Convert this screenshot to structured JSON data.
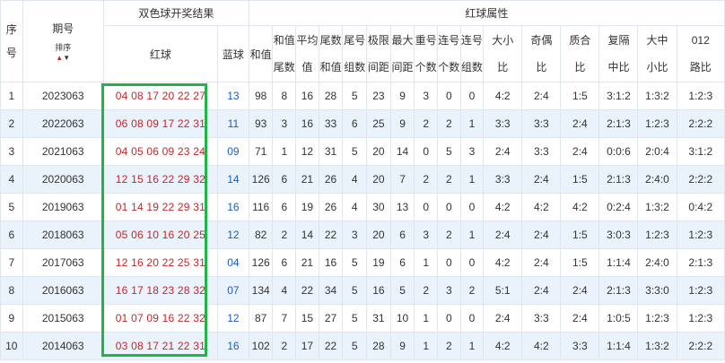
{
  "header": {
    "seq": "序号",
    "period": "期号",
    "sort_label": "排序",
    "sort_up": "▲",
    "sort_down": "▼",
    "group_title": "双色球开奖结果",
    "red_ball": "红球",
    "blue_ball": "蓝球",
    "attr_title": "红球属性",
    "cols": [
      "和值",
      "和值尾数",
      "平均值",
      "尾数和值",
      "尾号组数",
      "极限间距",
      "最大间距",
      "重号个数",
      "连号个数",
      "连号组数",
      "大小比",
      "奇偶比",
      "质合比",
      "复隔中比",
      "大中小比",
      "012路比"
    ]
  },
  "colors": {
    "red": "#c0282b",
    "blue": "#1a5fbf",
    "highlight": "#22b34a",
    "row_alt": "#eaf2fb"
  },
  "rows": [
    {
      "no": "1",
      "period": "2023063",
      "red": "04 08 17 20 22 27",
      "blue": "13",
      "v": [
        "98",
        "8",
        "16",
        "28",
        "5",
        "23",
        "9",
        "3",
        "0",
        "0",
        "4:2",
        "2:4",
        "1:5",
        "3:1:2",
        "1:3:2",
        "1:2:3"
      ]
    },
    {
      "no": "2",
      "period": "2022063",
      "red": "06 08 09 17 22 31",
      "blue": "11",
      "v": [
        "93",
        "3",
        "16",
        "33",
        "6",
        "25",
        "9",
        "2",
        "2",
        "1",
        "3:3",
        "3:3",
        "2:4",
        "2:1:3",
        "1:2:3",
        "2:2:2"
      ]
    },
    {
      "no": "3",
      "period": "2021063",
      "red": "04 05 06 09 23 24",
      "blue": "09",
      "v": [
        "71",
        "1",
        "12",
        "31",
        "5",
        "20",
        "14",
        "0",
        "5",
        "3",
        "2:4",
        "3:3",
        "2:4",
        "0:0:6",
        "2:0:4",
        "3:1:2"
      ]
    },
    {
      "no": "4",
      "period": "2020063",
      "red": "12 15 16 22 29 32",
      "blue": "14",
      "v": [
        "126",
        "6",
        "21",
        "26",
        "4",
        "20",
        "7",
        "2",
        "2",
        "1",
        "3:3",
        "2:4",
        "1:5",
        "2:1:3",
        "2:4:0",
        "2:2:2"
      ]
    },
    {
      "no": "5",
      "period": "2019063",
      "red": "01 14 19 22 29 31",
      "blue": "16",
      "v": [
        "116",
        "6",
        "19",
        "26",
        "4",
        "30",
        "13",
        "0",
        "0",
        "0",
        "4:2",
        "4:2",
        "4:2",
        "0:2:4",
        "1:3:2",
        "0:4:2"
      ]
    },
    {
      "no": "6",
      "period": "2018063",
      "red": "05 06 10 16 20 25",
      "blue": "12",
      "v": [
        "82",
        "2",
        "14",
        "22",
        "3",
        "20",
        "6",
        "3",
        "2",
        "1",
        "2:4",
        "2:4",
        "1:5",
        "3:0:3",
        "1:2:3",
        "1:2:3"
      ]
    },
    {
      "no": "7",
      "period": "2017063",
      "red": "12 16 20 22 25 31",
      "blue": "04",
      "v": [
        "126",
        "6",
        "21",
        "16",
        "5",
        "19",
        "6",
        "1",
        "0",
        "0",
        "4:2",
        "2:4",
        "1:5",
        "1:1:4",
        "2:4:0",
        "2:1:3"
      ]
    },
    {
      "no": "8",
      "period": "2016063",
      "red": "16 17 18 23 28 32",
      "blue": "07",
      "v": [
        "134",
        "4",
        "22",
        "34",
        "5",
        "16",
        "5",
        "2",
        "3",
        "2",
        "5:1",
        "2:4",
        "2:4",
        "2:1:3",
        "3:3:0",
        "1:2:3"
      ]
    },
    {
      "no": "9",
      "period": "2015063",
      "red": "01 07 09 16 22 32",
      "blue": "12",
      "v": [
        "87",
        "7",
        "15",
        "27",
        "5",
        "31",
        "10",
        "1",
        "0",
        "0",
        "2:4",
        "3:3",
        "2:4",
        "1:0:5",
        "1:2:3",
        "1:2:3"
      ]
    },
    {
      "no": "10",
      "period": "2014063",
      "red": "03 08 17 21 22 31",
      "blue": "16",
      "v": [
        "102",
        "2",
        "17",
        "22",
        "5",
        "28",
        "9",
        "1",
        "2",
        "1",
        "4:2",
        "4:2",
        "3:3",
        "1:1:4",
        "1:3:2",
        "2:2:2"
      ]
    }
  ]
}
